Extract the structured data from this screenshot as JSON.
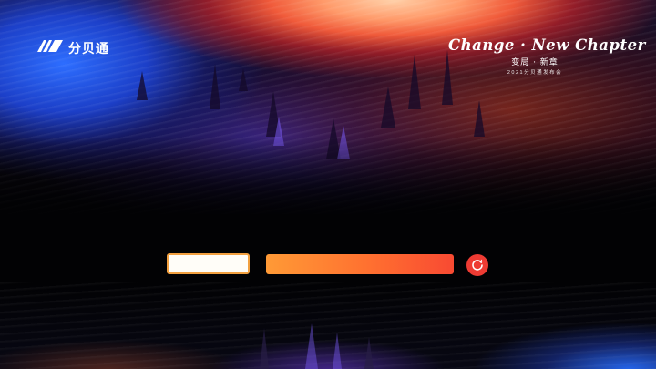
{
  "brand": {
    "name": "分贝通",
    "logo_icon": "fenbeitong-logo-icon"
  },
  "event": {
    "title_en": "Change · New Chapter",
    "title_cn": "变局 · 新章",
    "subtitle": "2021分贝通发布会"
  },
  "form": {
    "code_input_value": "",
    "code_input_placeholder": "",
    "submit_label": "",
    "refresh_icon": "refresh-icon"
  },
  "colors": {
    "accent_orange": "#ff7a30",
    "input_border": "#f2a040",
    "refresh_red": "#ee3b33",
    "background": "#020204"
  }
}
